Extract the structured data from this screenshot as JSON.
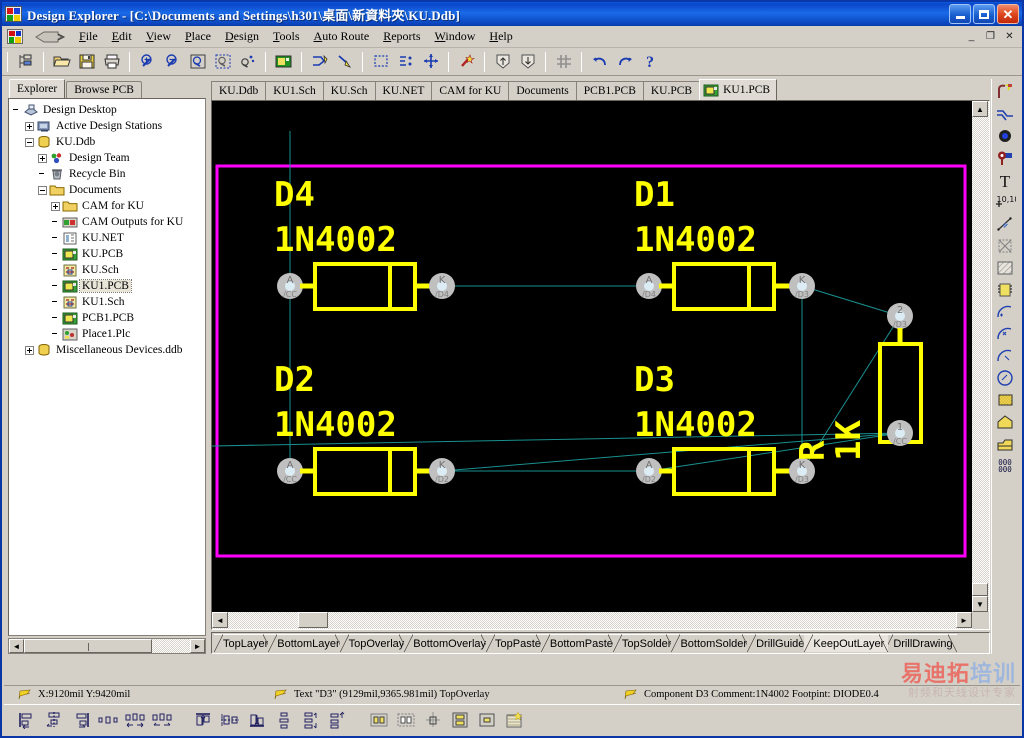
{
  "window": {
    "title": "Design Explorer - [C:\\Documents and Settings\\h301\\桌面\\新資料夾\\KU.Ddb]",
    "minimize_label": "_",
    "maximize_label": "□",
    "close_label": "✕"
  },
  "menu": {
    "items": [
      {
        "label": "File"
      },
      {
        "label": "Edit"
      },
      {
        "label": "View"
      },
      {
        "label": "Place"
      },
      {
        "label": "Design"
      },
      {
        "label": "Tools"
      },
      {
        "label": "Auto Route"
      },
      {
        "label": "Reports"
      },
      {
        "label": "Window"
      },
      {
        "label": "Help"
      }
    ],
    "mdi": {
      "minimize": "_",
      "restore": "❐",
      "close": "✕"
    }
  },
  "toolbar": {
    "buttons": [
      {
        "name": "explorer-panel-icon",
        "tip": "Toggle Design Explorer Panel"
      },
      {
        "name": "open-folder-icon",
        "tip": "Open"
      },
      {
        "name": "save-icon",
        "tip": "Save"
      },
      {
        "name": "print-icon",
        "tip": "Print"
      },
      {
        "name": "zoom-in-icon",
        "tip": "Zoom In"
      },
      {
        "name": "zoom-out-icon",
        "tip": "Zoom Out"
      },
      {
        "name": "zoom-document-icon",
        "tip": "Zoom Document"
      },
      {
        "name": "zoom-area-icon",
        "tip": "Zoom Area"
      },
      {
        "name": "zoom-selection-icon",
        "tip": "Zoom Selection"
      },
      {
        "name": "browse-component-icon",
        "tip": "Browse Component"
      },
      {
        "name": "interactive-route-icon",
        "tip": "Interactively Route"
      },
      {
        "name": "place-line-icon",
        "tip": "Place Line"
      },
      {
        "name": "select-area-icon",
        "tip": "Select Inside Area"
      },
      {
        "name": "deselect-icon",
        "tip": "Deselect All"
      },
      {
        "name": "move-icon",
        "tip": "Move Selection"
      },
      {
        "name": "drc-wand-icon",
        "tip": "Design Rule Check"
      },
      {
        "name": "up-pcb-icon",
        "tip": "Up a Level"
      },
      {
        "name": "down-pcb-icon",
        "tip": "Down a Level"
      },
      {
        "name": "grid-icon",
        "tip": "Toggle Grid"
      },
      {
        "name": "undo-icon",
        "tip": "Undo"
      },
      {
        "name": "redo-icon",
        "tip": "Redo"
      },
      {
        "name": "help-icon",
        "tip": "Help"
      }
    ]
  },
  "sidebar": {
    "tabs": [
      {
        "label": "Explorer",
        "active": true
      },
      {
        "label": "Browse PCB",
        "active": false
      }
    ],
    "tree": [
      {
        "label": "Design Desktop",
        "indent": 0,
        "expander": "none",
        "icon": "desktop-icon",
        "selected": false
      },
      {
        "label": "Active Design Stations",
        "indent": 1,
        "expander": "plus",
        "icon": "station-icon",
        "selected": false
      },
      {
        "label": "KU.Ddb",
        "indent": 1,
        "expander": "minus",
        "icon": "database-icon",
        "selected": false
      },
      {
        "label": "Design Team",
        "indent": 2,
        "expander": "plus",
        "icon": "team-icon",
        "selected": false
      },
      {
        "label": "Recycle Bin",
        "indent": 2,
        "expander": "none",
        "icon": "recycle-icon",
        "selected": false
      },
      {
        "label": "Documents",
        "indent": 2,
        "expander": "minus",
        "icon": "folder-icon",
        "selected": false
      },
      {
        "label": "CAM for KU",
        "indent": 3,
        "expander": "plus",
        "icon": "folder-icon",
        "selected": false
      },
      {
        "label": "CAM Outputs for KU",
        "indent": 3,
        "expander": "none",
        "icon": "cam-icon",
        "selected": false
      },
      {
        "label": "KU.NET",
        "indent": 3,
        "expander": "none",
        "icon": "net-icon",
        "selected": false
      },
      {
        "label": "KU.PCB",
        "indent": 3,
        "expander": "none",
        "icon": "pcb-icon",
        "selected": false
      },
      {
        "label": "KU.Sch",
        "indent": 3,
        "expander": "none",
        "icon": "sch-icon",
        "selected": false
      },
      {
        "label": "KU1.PCB",
        "indent": 3,
        "expander": "none",
        "icon": "pcb-icon",
        "selected": true
      },
      {
        "label": "KU1.Sch",
        "indent": 3,
        "expander": "none",
        "icon": "sch-icon",
        "selected": false
      },
      {
        "label": "PCB1.PCB",
        "indent": 3,
        "expander": "none",
        "icon": "pcb-icon",
        "selected": false
      },
      {
        "label": "Place1.Plc",
        "indent": 3,
        "expander": "none",
        "icon": "plc-icon",
        "selected": false
      },
      {
        "label": "Miscellaneous Devices.ddb",
        "indent": 1,
        "expander": "plus",
        "icon": "database-icon",
        "selected": false
      }
    ],
    "scroll": {
      "left_arrow": "◄",
      "right_arrow": "►"
    }
  },
  "document_tabs": [
    {
      "label": "KU.Ddb",
      "active": false
    },
    {
      "label": "KU1.Sch",
      "active": false
    },
    {
      "label": "KU.Sch",
      "active": false
    },
    {
      "label": "KU.NET",
      "active": false
    },
    {
      "label": "CAM for KU",
      "active": false
    },
    {
      "label": "Documents",
      "active": false
    },
    {
      "label": "PCB1.PCB",
      "active": false
    },
    {
      "label": "KU.PCB",
      "active": false
    },
    {
      "label": "KU1.PCB",
      "active": true
    }
  ],
  "pcb": {
    "background_color": "#000000",
    "keepout_color": "#ff00ff",
    "overlay_color": "#ffff00",
    "ratsnest_color": "#1a8f8f",
    "pad_color": "#c8c8c8",
    "components": [
      {
        "designator": "D4",
        "comment": "1N4002",
        "pad_a": "A",
        "pad_a_net": "/CC",
        "pad_k": "K",
        "pad_k_net": "/D4"
      },
      {
        "designator": "D1",
        "comment": "1N4002",
        "pad_a": "A",
        "pad_a_net": "/D4",
        "pad_k": "K",
        "pad_k_net": "/D3"
      },
      {
        "designator": "D2",
        "comment": "1N4002",
        "pad_a": "A",
        "pad_a_net": "/CC",
        "pad_k": "K",
        "pad_k_net": "/D2"
      },
      {
        "designator": "D3",
        "comment": "1N4002",
        "pad_a": "A",
        "pad_a_net": "/D2",
        "pad_k": "K",
        "pad_k_net": "/D3"
      },
      {
        "designator": "R",
        "comment": "1K",
        "pad_a": "2",
        "pad_a_net": "/D3",
        "pad_k": "1",
        "pad_k_net": "/CC"
      }
    ],
    "scroll": {
      "up": "▲",
      "down": "▼",
      "left": "◄",
      "right": "►"
    }
  },
  "layer_tabs": [
    {
      "label": "TopLayer",
      "active": false
    },
    {
      "label": "BottomLayer",
      "active": false
    },
    {
      "label": "TopOverlay",
      "active": false
    },
    {
      "label": "BottomOverlay",
      "active": false
    },
    {
      "label": "TopPaste",
      "active": false
    },
    {
      "label": "BottomPaste",
      "active": false
    },
    {
      "label": "TopSolder",
      "active": false
    },
    {
      "label": "BottomSolder",
      "active": false
    },
    {
      "label": "DrillGuide",
      "active": false
    },
    {
      "label": "KeepOutLayer",
      "active": true
    },
    {
      "label": "DrillDrawing",
      "active": false
    }
  ],
  "right_toolbar": [
    {
      "name": "interactive-routing-icon"
    },
    {
      "name": "place-track-icon"
    },
    {
      "name": "place-via-icon"
    },
    {
      "name": "place-pad-icon"
    },
    {
      "name": "place-string-icon"
    },
    {
      "name": "place-coordinate-icon"
    },
    {
      "name": "place-dimension-icon"
    },
    {
      "name": "place-keepout-icon"
    },
    {
      "name": "place-fill-icon"
    },
    {
      "name": "place-component-icon"
    },
    {
      "name": "place-arc-center-icon"
    },
    {
      "name": "place-arc-edge-icon"
    },
    {
      "name": "place-arc-any-angle-icon"
    },
    {
      "name": "place-full-circle-icon"
    },
    {
      "name": "place-polygon-plane-icon"
    },
    {
      "name": "place-split-plane-icon"
    },
    {
      "name": "place-room-icon"
    },
    {
      "name": "array-paste-icon"
    }
  ],
  "bottom_toolbar": [
    {
      "name": "align-left-icon"
    },
    {
      "name": "align-horizontal-center-icon"
    },
    {
      "name": "align-right-icon"
    },
    {
      "name": "space-equally-horizontal-icon"
    },
    {
      "name": "increase-horizontal-spacing-icon"
    },
    {
      "name": "decrease-horizontal-spacing-icon"
    },
    {
      "name": "align-top-icon"
    },
    {
      "name": "align-vertical-center-icon"
    },
    {
      "name": "align-bottom-icon"
    },
    {
      "name": "space-equally-vertical-icon"
    },
    {
      "name": "increase-vertical-spacing-icon"
    },
    {
      "name": "decrease-vertical-spacing-icon"
    },
    {
      "name": "position-component-text-icon"
    },
    {
      "name": "move-to-grid-icon"
    },
    {
      "name": "move-selection-icon"
    },
    {
      "name": "flip-selection-icon"
    },
    {
      "name": "rotate-selection-icon"
    },
    {
      "name": "arrange-components-icon"
    }
  ],
  "status": {
    "coordinates": "X:9120mil Y:9420mil",
    "object": "Text \"D3\" (9129mil,9365.981mil)  TopOverlay",
    "component_info": "Component D3 Comment:1N4002 Footpint: DIODE0.4"
  },
  "watermark": {
    "line1_red": "易迪拓",
    "line1_blue": "培训",
    "line2": "射频和天线设计专家"
  }
}
